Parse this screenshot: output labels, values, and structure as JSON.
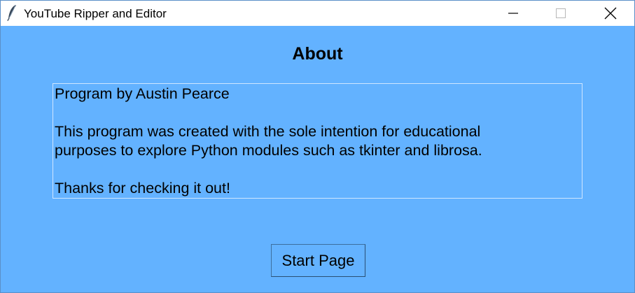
{
  "window": {
    "title": "YouTube Ripper and Editor",
    "controls": {
      "minimize_icon": "minimize-icon",
      "maximize_icon": "maximize-icon",
      "close_icon": "close-icon"
    }
  },
  "page": {
    "heading": "About",
    "about_lines": {
      "author": "Program by Austin Pearce",
      "purpose_line1": "This program was created with the sole intention for educational",
      "purpose_line2": "purposes to explore Python modules such as tkinter and librosa.",
      "thanks": "Thanks for checking it out!"
    },
    "start_button_label": "Start Page"
  },
  "colors": {
    "background": "#63b2ff",
    "titlebar": "#ffffff",
    "text": "#000000"
  }
}
